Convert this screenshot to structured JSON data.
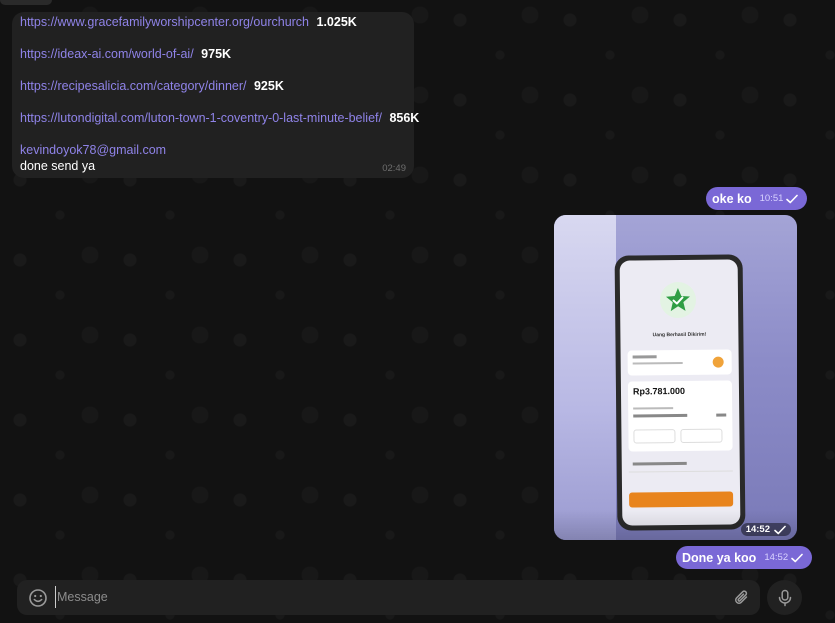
{
  "incoming_message": {
    "links": [
      {
        "url": "https://www.gracefamilyworshipcenter.org/ourchurch",
        "count": "1.025K"
      },
      {
        "url": "https://ideax-ai.com/world-of-ai/",
        "count": "975K"
      },
      {
        "url": "https://recipesalicia.com/category/dinner/",
        "count": "925K"
      },
      {
        "url": "https://lutondigital.com/luton-town-1-coventry-0-last-minute-belief/",
        "count": "856K"
      }
    ],
    "email": "kevindoyok78@gmail.com",
    "text": "done send ya",
    "time": "02:49"
  },
  "outgoing_message_1": {
    "text": "oke ko",
    "time": "10:51"
  },
  "photo_message": {
    "time": "14:52",
    "screenshot": {
      "title": "Uang Berhasil Dikirim!",
      "amount": "Rp3.781.000"
    }
  },
  "outgoing_message_2": {
    "text": "Done ya koo",
    "time": "14:52"
  },
  "composer": {
    "placeholder": "Message"
  },
  "colors": {
    "outgoing_bubble": "#7a68d6",
    "incoming_bubble": "#212121",
    "link": "#8f83e8",
    "background": "#121212"
  },
  "icons": {
    "emoji": "smiley-icon",
    "attach": "paperclip-icon",
    "mic": "microphone-icon",
    "read": "check-icon"
  }
}
